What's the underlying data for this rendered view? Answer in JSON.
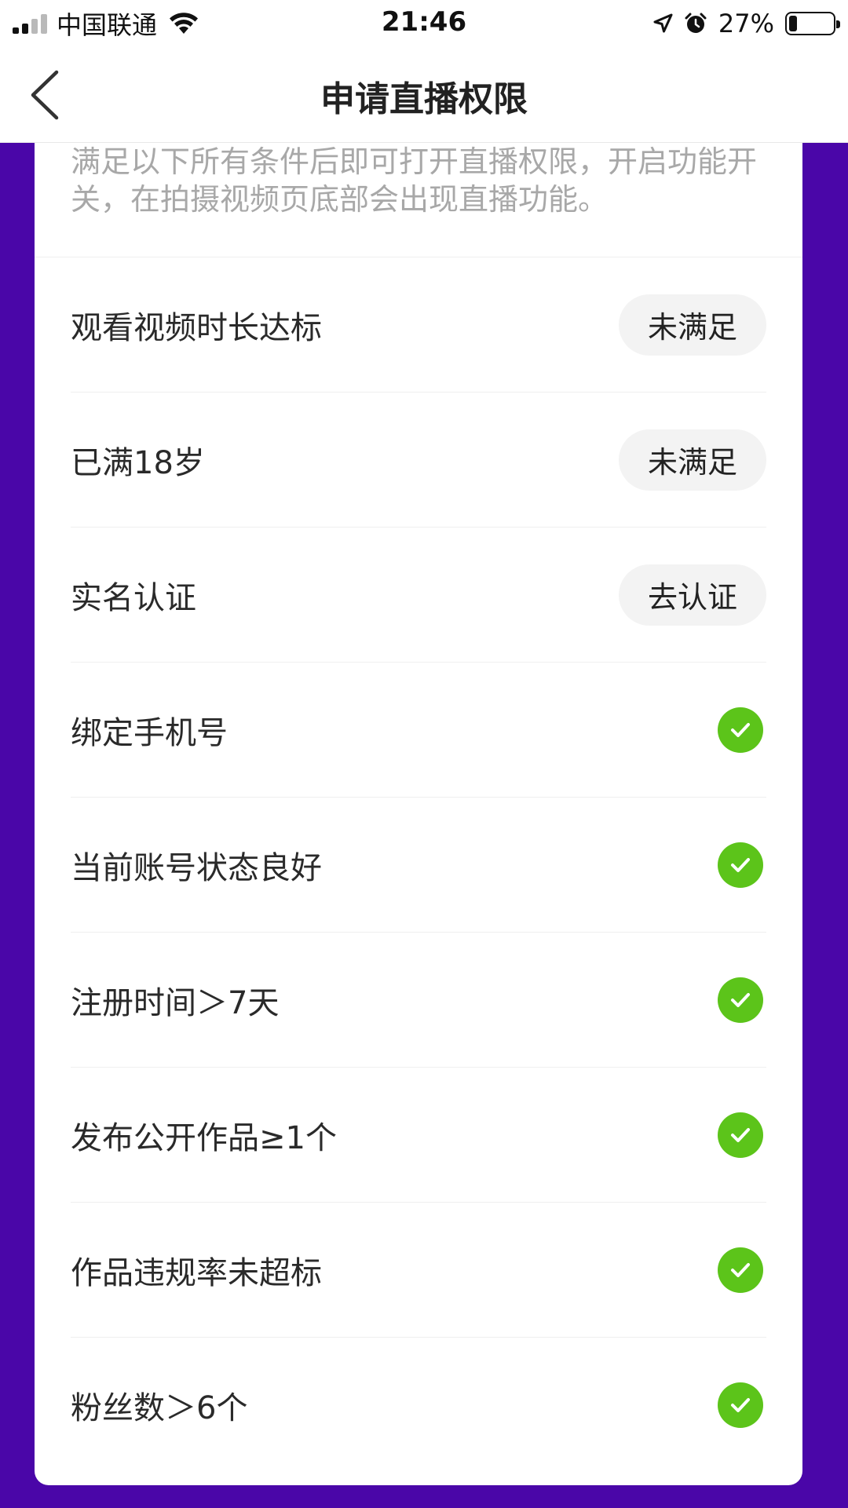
{
  "status_bar": {
    "carrier": "中国联通",
    "time": "21:46",
    "battery_percent": "27%",
    "battery_level": 0.27
  },
  "nav": {
    "title": "申请直播权限",
    "back_icon": "chevron-left-icon"
  },
  "intro": {
    "text": "满足以下所有条件后即可打开直播权限，开启功能开关，在拍摄视频页底部会出现直播功能。"
  },
  "requirements": [
    {
      "label": "观看视频时长达标",
      "status": "pill",
      "action": "未满足"
    },
    {
      "label": "已满18岁",
      "status": "pill",
      "action": "未满足"
    },
    {
      "label": "实名认证",
      "status": "pill",
      "action": "去认证"
    },
    {
      "label": "绑定手机号",
      "status": "done"
    },
    {
      "label": "当前账号状态良好",
      "status": "done"
    },
    {
      "label": "注册时间＞7天",
      "status": "done"
    },
    {
      "label": "发布公开作品≥1个",
      "status": "done"
    },
    {
      "label": "作品违规率未超标",
      "status": "done"
    },
    {
      "label": "粉丝数＞6个",
      "status": "done"
    }
  ],
  "colors": {
    "background": "#4a06a8",
    "check_green": "#5cc41a",
    "pill_bg": "#f3f3f3",
    "hint_text": "#a8a8a8"
  }
}
